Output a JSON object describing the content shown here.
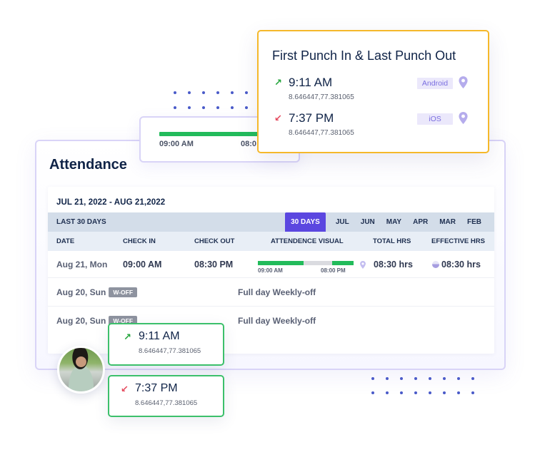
{
  "attendance": {
    "title": "Attendance",
    "date_range": "JUL 21, 2022 - AUG 21,2022",
    "filter_label": "LAST 30 DAYS",
    "filter_tabs": [
      "30 DAYS",
      "JUL",
      "JUN",
      "MAY",
      "APR",
      "MAR",
      "FEB"
    ],
    "active_filter": "30 DAYS",
    "columns": [
      "DATE",
      "CHECK IN",
      "CHECK OUT",
      "ATTENDENCE VISUAL",
      "TOTAL HRS",
      "EFFECTIVE HRS"
    ],
    "rows": [
      {
        "date": "Aug 21, Mon",
        "check_in": "09:00 AM",
        "check_out": "08:30 PM",
        "visual_start": "09:00 AM",
        "visual_end": "08:00 PM",
        "total_hrs": "08:30 hrs",
        "effective_hrs": "08:30 hrs"
      },
      {
        "date": "Aug 20, Sun",
        "badge": "W-OFF",
        "note": "Full day Weekly-off"
      },
      {
        "date": "Aug 20, Sun",
        "badge": "W-OFF",
        "note": "Full day Weekly-off"
      }
    ]
  },
  "mini_card": {
    "start": "09:00 AM",
    "end_partial": "08:0"
  },
  "punch_card": {
    "title": "First Punch In & Last Punch Out",
    "punch_in": {
      "time": "9:11 AM",
      "coords": "8.646447,77.381065",
      "device": "Android"
    },
    "punch_out": {
      "time": "7:37 PM",
      "coords": "8.646447,77.381065",
      "device": "iOS"
    }
  },
  "bottom_cards": {
    "punch_in": {
      "time": "9:11 AM",
      "coords": "8.646447,77.381065"
    },
    "punch_out": {
      "time": "7:37 PM",
      "coords": "8.646447,77.381065"
    }
  },
  "icons": {
    "arrow_up": "↗",
    "arrow_down": "↙"
  },
  "colors": {
    "accent": "#5b47e0",
    "punch_border": "#f5b82a",
    "success": "#22bb5b",
    "punch_in_arrow": "#22a43a",
    "punch_out_arrow": "#e5485c",
    "badge_bg": "#ebe8fb",
    "badge_text": "#7a6ee0"
  }
}
